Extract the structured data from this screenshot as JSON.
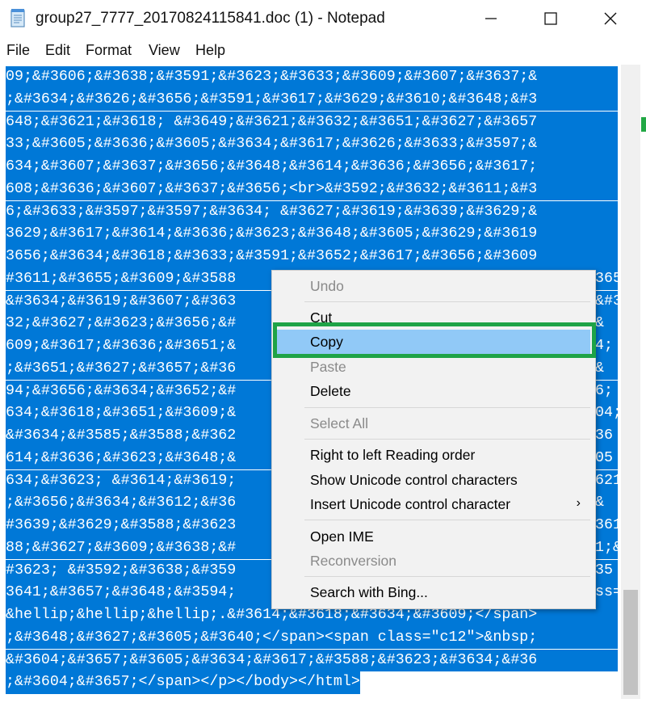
{
  "window": {
    "title": "group27_7777_20170824115841.doc (1) - Notepad",
    "minimize_glyph": "—",
    "maximize_glyph": "☐",
    "close_glyph": "✕"
  },
  "menu": {
    "file": "File",
    "edit": "Edit",
    "format": "Format",
    "view": "View",
    "help": "Help"
  },
  "editor": {
    "lines": [
      "09;&#3606;&#3638;&#3591;&#3623;&#3633;&#3609;&#3607;&#3637;&",
      ";&#3634;&#3626;&#3656;&#3591;&#3617;&#3629;&#3610;&#3648;&#3",
      "648;&#3621;&#3618; &#3649;&#3621;&#3632;&#3651;&#3627;&#3657",
      "33;&#3605;&#3636;&#3605;&#3634;&#3617;&#3626;&#3633;&#3597;&",
      "634;&#3607;&#3637;&#3656;&#3648;&#3614;&#3636;&#3656;&#3617;",
      "608;&#3636;&#3607;&#3637;&#3656;<br>&#3592;&#3632;&#3611;&#3",
      "6;&#3633;&#3597;&#3597;&#3634; &#3627;&#3619;&#3639;&#3629;&",
      "3629;&#3617;&#3614;&#3636;&#3623;&#3648;&#3605;&#3629;&#3619",
      "3656;&#3634;&#3618;&#3633;&#3591;&#3652;&#3617;&#3656;&#3609",
      "#3611;&#3655;&#3609;&#3588",
      "&#3634;&#3619;&#3607;&#363",
      "32;&#3627;&#3623;&#3656;&#",
      "609;&#3617;&#3636;&#3651;&",
      ";&#3651;&#3627;&#3657;&#36",
      "94;&#3656;&#3634;&#3652;&#",
      "634;&#3618;&#3651;&#3609;&",
      "&#3634;&#3585;&#3588;&#362",
      "614;&#3636;&#3623;&#3648;&",
      "634;&#3623; &#3614;&#3619;",
      ";&#3656;&#3634;&#3612;&#36",
      "#3639;&#3629;&#3588;&#3623",
      "88;&#3627;&#3609;&#3638;&#",
      "#3623; &#3592;&#3638;&#359",
      "3641;&#3657;&#3648;&#3594;",
      "&hellip;&hellip;&hellip;.&#3614;&#3618;&#3634;&#3609;</span>",
      ";&#3648;&#3627;&#3605;&#3640;</span><span class=\"c12\">&nbsp;",
      "&#3604;&#3657;&#3605;&#3634;&#3617;&#3588;&#3623;&#3634;&#36",
      ";&#3604;&#3657;</span></p></body></html>"
    ],
    "right_fragments": {
      "9": "365",
      "10": "&#36",
      "11": "&",
      "12": "4;",
      "13": "&",
      "14": "6;",
      "15": "04;",
      "16": "36",
      "17": "05",
      "18": "621",
      "19": "&",
      "20": "361",
      "21": "1;&",
      "22": "35",
      "23": "ss="
    }
  },
  "context_menu": {
    "undo": "Undo",
    "cut": "Cut",
    "copy": "Copy",
    "paste": "Paste",
    "delete": "Delete",
    "select_all": "Select All",
    "rtl": "Right to left Reading order",
    "show_unicode": "Show Unicode control characters",
    "insert_unicode": "Insert Unicode control character",
    "open_ime": "Open IME",
    "reconversion": "Reconversion",
    "search_bing": "Search with Bing...",
    "submenu_arrow": "›"
  },
  "colors": {
    "selection": "#0078d7",
    "hover": "#91c9f7",
    "highlight_border": "#1fa347"
  }
}
